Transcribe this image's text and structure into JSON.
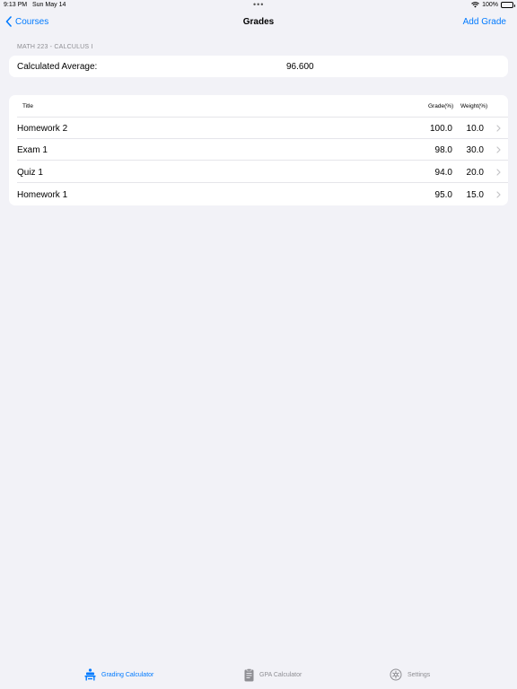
{
  "status_bar": {
    "time": "9:13 PM",
    "date": "Sun May 14",
    "battery": "100%"
  },
  "nav": {
    "back_label": "Courses",
    "title": "Grades",
    "action_label": "Add Grade"
  },
  "course": {
    "section_header": "MATH 223 - CALCULUS I"
  },
  "average": {
    "label": "Calculated Average:",
    "value": "96.600"
  },
  "table": {
    "headers": {
      "title": "Title",
      "grade": "Grade(%)",
      "weight": "Weight(%)"
    },
    "rows": [
      {
        "title": "Homework 2",
        "grade": "100.0",
        "weight": "10.0"
      },
      {
        "title": "Exam 1",
        "grade": "98.0",
        "weight": "30.0"
      },
      {
        "title": "Quiz 1",
        "grade": "94.0",
        "weight": "20.0"
      },
      {
        "title": "Homework 1",
        "grade": "95.0",
        "weight": "15.0"
      }
    ]
  },
  "tabs": [
    {
      "label": "Grading Calculator",
      "icon": "desk-icon",
      "active": true
    },
    {
      "label": "GPA Calculator",
      "icon": "clipboard-icon",
      "active": false
    },
    {
      "label": "Settings",
      "icon": "gear-icon",
      "active": false
    }
  ],
  "colors": {
    "accent": "#007aff",
    "background": "#f2f2f7",
    "inactive": "#8e8e93"
  }
}
